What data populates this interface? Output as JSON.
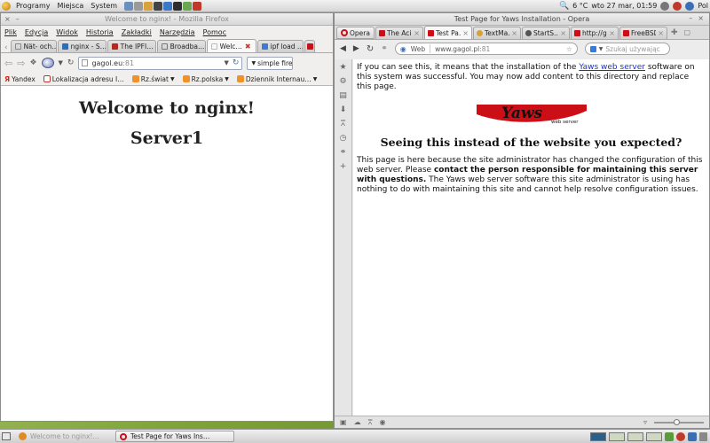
{
  "top_panel": {
    "menus": [
      "Programy",
      "Miejsca",
      "System"
    ],
    "weather": "6 °C",
    "clock": "wto 27 mar, 01:59",
    "user": "Pol",
    "colors": {
      "launcher": [
        "#6a8fbf",
        "#9a9a9a",
        "#d9a23b",
        "#444444",
        "#3c78c8",
        "#2e2e2e",
        "#6aa84f",
        "#c0392b"
      ]
    }
  },
  "firefox": {
    "title": "Welcome to nginx! - Mozilla Firefox",
    "menu": [
      "Plik",
      "Edycja",
      "Widok",
      "Historia",
      "Zakładki",
      "Narzędzia",
      "Pomoc"
    ],
    "tabs": [
      {
        "label": "Nät- och…",
        "color": "#7a7a7a",
        "active": false
      },
      {
        "label": "nginx - S…",
        "color": "#2f6db5",
        "active": false
      },
      {
        "label": "The IPFI…",
        "color": "#b5281e",
        "active": false
      },
      {
        "label": "Broadba…",
        "color": "#777777",
        "active": false
      },
      {
        "label": "Welc…",
        "color": "#bbbbbb",
        "active": true
      },
      {
        "label": "ipf load …",
        "color": "#3a7bd5",
        "active": false
      }
    ],
    "url": "gagol.eu",
    "url_port": ":81",
    "search_value": "simple firev",
    "bookmarks": [
      {
        "label": "Yandex",
        "icon": "yandex-icon",
        "color": "#d82a1f"
      },
      {
        "label": "Lokalizacja adresu I…",
        "icon": "checkbox-icon",
        "color": "#c0392b"
      },
      {
        "label": "Rz.świat",
        "icon": "rss-icon",
        "color": "#f0922a"
      },
      {
        "label": "Rz.polska",
        "icon": "rss-icon",
        "color": "#f0922a"
      },
      {
        "label": "Dziennik Internau…",
        "icon": "rss-icon",
        "color": "#f0922a"
      }
    ],
    "page": {
      "heading1": "Welcome to nginx!",
      "heading2": "Server1"
    }
  },
  "opera": {
    "title": "Test Page for Yaws Installation - Opera",
    "menu_label": "Opera",
    "tabs": [
      {
        "label": "The Aci…",
        "active": false
      },
      {
        "label": "Test Pa…",
        "active": true
      },
      {
        "label": "TextMa…",
        "active": false
      },
      {
        "label": "StartS…",
        "active": false
      },
      {
        "label": "http://g…",
        "active": false
      },
      {
        "label": "FreeBSD",
        "active": false
      }
    ],
    "url_label": "Web",
    "url": "www.gagol.pl",
    "url_port": ":81",
    "search_placeholder": "Szukaj używając",
    "page": {
      "intro_before": "If you can see this, it means that the installation of the ",
      "intro_link": "Yaws web server",
      "intro_after": " software on this system was successful. You may now add content to this directory and replace this page.",
      "logo_text": "Yaws",
      "logo_sub": "web server",
      "heading": "Seeing this instead of the website you expected?",
      "body_before": "This page is here because the site administrator has changed the configuration of this web server. Please ",
      "body_bold": "contact the person responsible for maintaining this server with questions.",
      "body_after": " The Yaws web server software this site administrator is using has nothing to do with maintaining this site and cannot help resolve configuration issues."
    },
    "brand_color": "#cc0f16"
  },
  "bottom_panel": {
    "tasks": [
      {
        "label": "Welcome to nginx!…",
        "active": false
      },
      {
        "label": "Test Page for Yaws Ins…",
        "active": true
      }
    ]
  }
}
